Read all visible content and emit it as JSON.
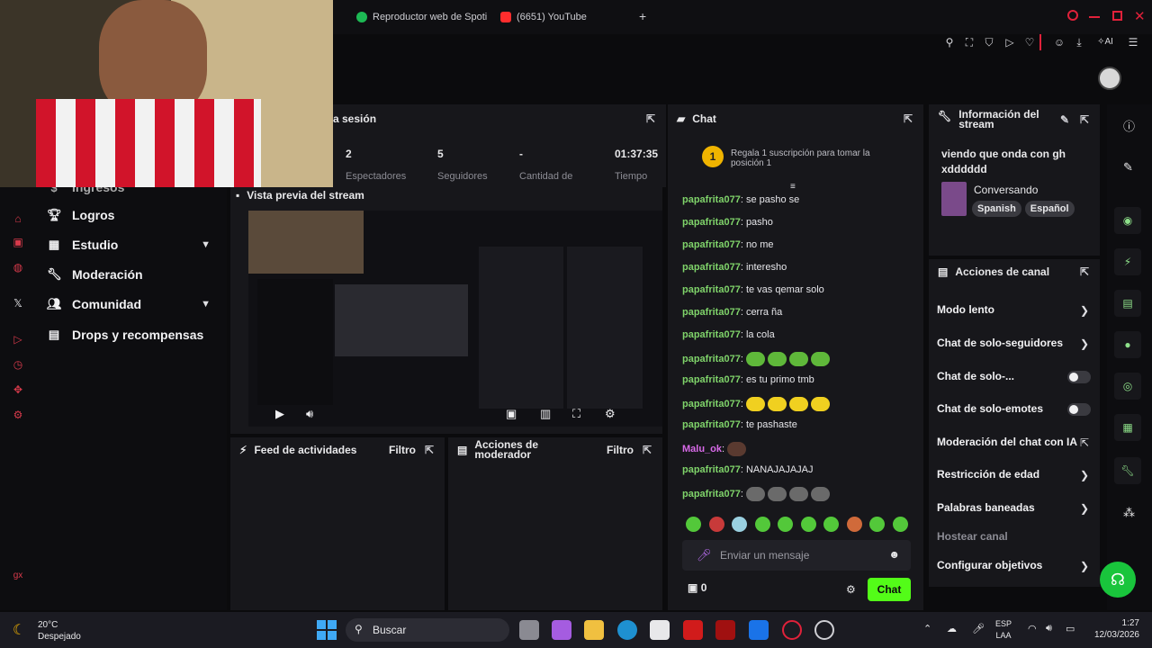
{
  "browser": {
    "tabs": [
      {
        "label": "Reproductor web de Spoti"
      },
      {
        "label": "(6651) YouTube"
      }
    ],
    "new_tab": "+"
  },
  "session": {
    "title": "a sesión",
    "stats": [
      {
        "value": "2",
        "label": "Espectadores"
      },
      {
        "value": "5",
        "label": "Seguidores"
      },
      {
        "value": "-",
        "label": "Cantidad de"
      },
      {
        "value": "01:37:35",
        "label": "Tiempo"
      }
    ]
  },
  "left_nav": {
    "partial_top": "Ingresos",
    "items": [
      {
        "label": "Logros",
        "expandable": false
      },
      {
        "label": "Estudio",
        "expandable": true
      },
      {
        "label": "Moderación",
        "expandable": false
      },
      {
        "label": "Comunidad",
        "expandable": true
      },
      {
        "label": "Drops y recompensas",
        "expandable": false
      }
    ]
  },
  "preview": {
    "title": "Vista previa del stream"
  },
  "feed": {
    "title": "Feed de actividades",
    "filter": "Filtro"
  },
  "mod_actions": {
    "title": "Acciones de moderador",
    "filter": "Filtro"
  },
  "chat": {
    "title": "Chat",
    "goal_rank": "1",
    "goal_text": "Regala 1 suscripción para tomar la posición 1",
    "messages": [
      {
        "user": "papafrita077",
        "text": "se pasho se"
      },
      {
        "user": "papafrita077",
        "text": "pasho"
      },
      {
        "user": "papafrita077",
        "text": "no me"
      },
      {
        "user": "papafrita077",
        "text": "interesho"
      },
      {
        "user": "papafrita077",
        "text": "te vas qemar solo"
      },
      {
        "user": "papafrita077",
        "text": "cerra ña"
      },
      {
        "user": "papafrita077",
        "text": "la cola"
      },
      {
        "user": "papafrita077",
        "text": ""
      },
      {
        "user": "papafrita077",
        "text": "es tu primo tmb"
      },
      {
        "user": "papafrita077",
        "text": ""
      },
      {
        "user": "papafrita077",
        "text": "te pashaste"
      },
      {
        "user": "Malu_ok",
        "text": ""
      },
      {
        "user": "papafrita077",
        "text": "NANAJAJAJAJ"
      },
      {
        "user": "papafrita077",
        "text": ""
      }
    ],
    "input_placeholder": "Enviar un mensaje",
    "points": "0",
    "send_label": "Chat"
  },
  "stream_info": {
    "title": "Información del stream",
    "stream_title": "viendo que onda con gh xdddddd",
    "category": "Conversando",
    "tags": [
      "Spanish",
      "Español"
    ]
  },
  "channel_actions": {
    "title": "Acciones de canal",
    "items": [
      {
        "label": "Modo lento",
        "control": "chevron"
      },
      {
        "label": "Chat de solo-seguidores",
        "control": "chevron"
      },
      {
        "label": "Chat de solo-...",
        "control": "toggle"
      },
      {
        "label": "Chat de solo-emotes",
        "control": "toggle"
      },
      {
        "label": "Moderación del chat con IA",
        "control": "external"
      },
      {
        "label": "Restricción de edad",
        "control": "chevron"
      },
      {
        "label": "Palabras baneadas",
        "control": "chevron"
      },
      {
        "label": "Hostear canal",
        "control": "none"
      },
      {
        "label": "Configurar objetivos",
        "control": "chevron"
      }
    ]
  },
  "taskbar": {
    "weather_temp": "20°C",
    "weather_desc": "Despejado",
    "search_placeholder": "Buscar",
    "lang_top": "ESP",
    "lang_bottom": "LAA",
    "time": "1:27",
    "date": "12/03/2026"
  },
  "colors": {
    "accent": "#53fc18",
    "brand_red": "#e0213a",
    "panel": "#17171b",
    "bg": "#0b0b0d"
  }
}
